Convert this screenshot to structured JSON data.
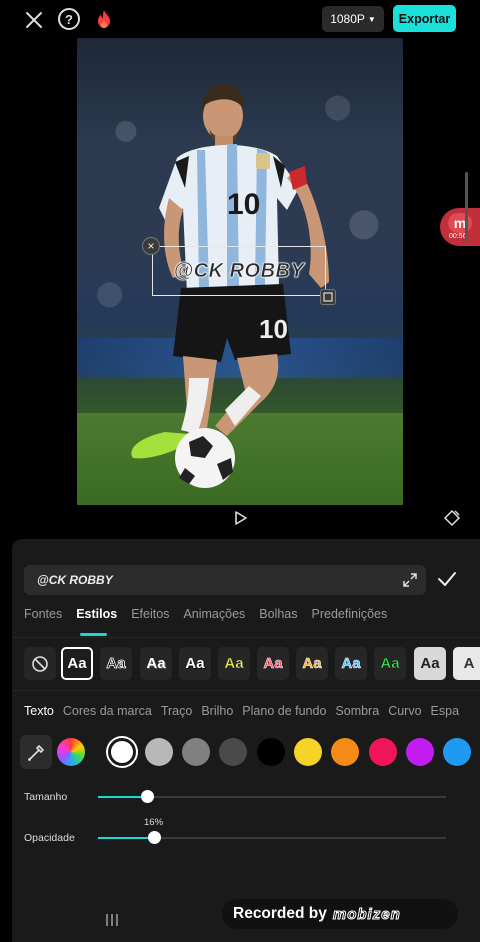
{
  "top_bar": {
    "close_icon": "close-x-icon",
    "help_label": "?",
    "flame_icon": "flame-icon",
    "resolution": "1080P",
    "export_label": "Exportar",
    "accent_color": "#19e0d8"
  },
  "preview": {
    "overlay_text": "@CK ROBBY",
    "recording_badge": {
      "letter": "m",
      "time": "00:56"
    }
  },
  "editor": {
    "text_value": "@CK ROBBY",
    "tabs": [
      {
        "label": "Fontes",
        "active": false
      },
      {
        "label": "Estilos",
        "active": true
      },
      {
        "label": "Efeitos",
        "active": false
      },
      {
        "label": "Animações",
        "active": false
      },
      {
        "label": "Bolhas",
        "active": false
      },
      {
        "label": "Predefinições",
        "active": false
      }
    ],
    "style_presets": [
      {
        "label": "",
        "type": "none"
      },
      {
        "label": "Aa",
        "color": "#ffffff",
        "selected": true
      },
      {
        "label": "Aa",
        "color": "#ffffff",
        "outline": "#000000"
      },
      {
        "label": "Aa",
        "color": "#ffffff"
      },
      {
        "label": "Aa",
        "color": "#ffffff"
      },
      {
        "label": "Aa",
        "color": "#f2f24a"
      },
      {
        "label": "Aa",
        "color": "#ff4d6d"
      },
      {
        "label": "Aa",
        "color": "#ffaa33"
      },
      {
        "label": "Aa",
        "color": "#4dc3ff"
      },
      {
        "label": "Aa",
        "color": "#33ee55"
      },
      {
        "label": "Aa",
        "color": "#222222",
        "background": "#d8d8d8"
      },
      {
        "label": "A",
        "color": "#333333",
        "background": "#e8e8e8"
      }
    ],
    "subtabs": [
      {
        "label": "Texto",
        "active": true
      },
      {
        "label": "Cores da marca",
        "active": false
      },
      {
        "label": "Traço",
        "active": false
      },
      {
        "label": "Brilho",
        "active": false
      },
      {
        "label": "Plano de fundo",
        "active": false
      },
      {
        "label": "Sombra",
        "active": false
      },
      {
        "label": "Curvo",
        "active": false
      },
      {
        "label": "Espa",
        "active": false
      }
    ],
    "colors": [
      "#ffffff",
      "#b8b8b8",
      "#808080",
      "#4a4a4a",
      "#000000",
      "#f5d327",
      "#f58a16",
      "#f0155a",
      "#c21cf2",
      "#1e9af2"
    ],
    "selected_color": "#ffffff",
    "sliders": [
      {
        "label": "Tamanho",
        "value_fraction": 0.14,
        "value_text": ""
      },
      {
        "label": "Opacidade",
        "value_fraction": 0.16,
        "value_text": "16%"
      }
    ]
  },
  "watermark": {
    "recorded_label": "Recorded by",
    "brand": "mobizen"
  }
}
